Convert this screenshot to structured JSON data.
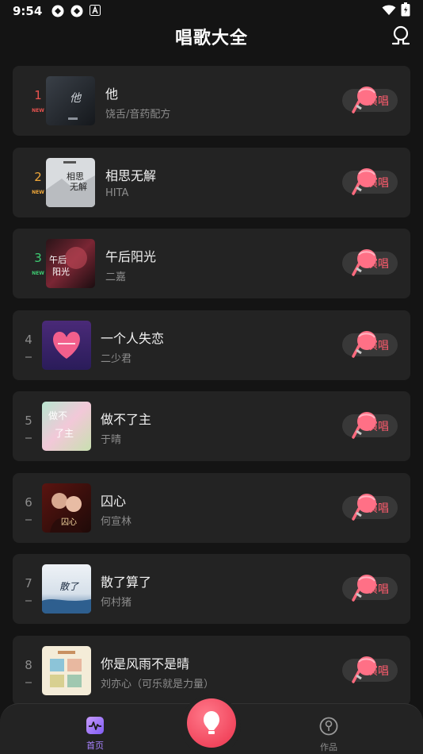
{
  "status_bar": {
    "time": "9:54"
  },
  "header": {
    "title": "唱歌大全"
  },
  "songs": [
    {
      "rank": "1",
      "tag": "NEW",
      "title": "他",
      "artist": "饶舌/音药配方",
      "rank_color": "#e8534f"
    },
    {
      "rank": "2",
      "tag": "NEW",
      "title": "相思无解",
      "artist": "HITA",
      "rank_color": "#f0a83a"
    },
    {
      "rank": "3",
      "tag": "NEW",
      "title": "午后阳光",
      "artist": "二嘉",
      "rank_color": "#3ecb72"
    },
    {
      "rank": "4",
      "tag": "",
      "title": "一个人失恋",
      "artist": "二少君",
      "rank_color": "#8c8c8c"
    },
    {
      "rank": "5",
      "tag": "",
      "title": "做不了主",
      "artist": "于晴",
      "rank_color": "#8c8c8c"
    },
    {
      "rank": "6",
      "tag": "",
      "title": "囚心",
      "artist": "何宣林",
      "rank_color": "#8c8c8c"
    },
    {
      "rank": "7",
      "tag": "",
      "title": "散了算了",
      "artist": "何村猪",
      "rank_color": "#8c8c8c"
    },
    {
      "rank": "8",
      "tag": "",
      "title": "你是风雨不是晴",
      "artist": "刘亦心（可乐就是力量）",
      "rank_color": "#8c8c8c"
    }
  ],
  "sing_label": "演唱",
  "bottom_nav": {
    "home_label": "首页",
    "works_label": "作品"
  },
  "colors": {
    "accent": "#ff5c6e",
    "nav_active": "#a883ff",
    "background": "#141414",
    "card": "#232323"
  }
}
